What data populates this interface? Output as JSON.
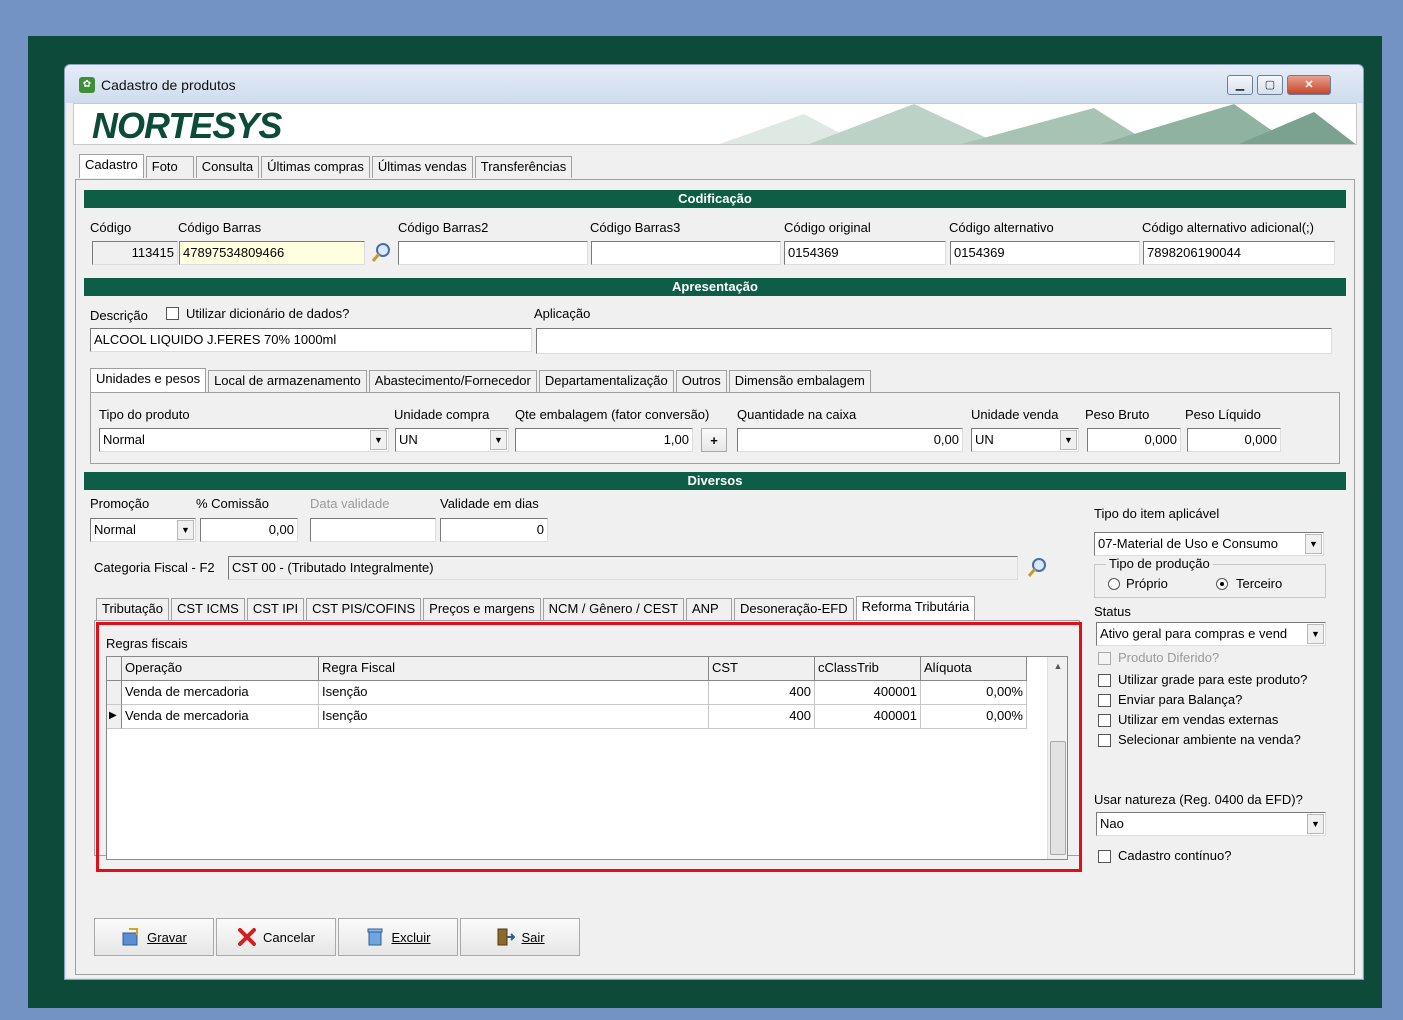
{
  "window": {
    "title": "Cadastro de produtos",
    "logo": "NORTESYS"
  },
  "main_tabs": [
    "Cadastro",
    "Foto",
    "Consulta",
    "Últimas compras",
    "Últimas vendas",
    "Transferências"
  ],
  "codificacao": {
    "header": "Codificação",
    "codigo_label": "Código",
    "codigo": "113415",
    "barras_label": "Código Barras",
    "barras": "47897534809466",
    "barras2_label": "Código Barras2",
    "barras2": "",
    "barras3_label": "Código Barras3",
    "barras3": "",
    "original_label": "Código original",
    "original": "0154369",
    "alternativo_label": "Código alternativo",
    "alternativo": "0154369",
    "alt_adicional_label": "Código alternativo adicional(;)",
    "alt_adicional": "7898206190044"
  },
  "apresentacao": {
    "header": "Apresentação",
    "descricao_label": "Descrição",
    "dicionario_label": "Utilizar dicionário de dados?",
    "descricao": "ALCOOL LIQUIDO J.FERES 70% 1000ml",
    "aplicacao_label": "Aplicação",
    "aplicacao": ""
  },
  "sub_tabs": [
    "Unidades e pesos",
    "Local de armazenamento",
    "Abastecimento/Fornecedor",
    "Departamentalização",
    "Outros",
    "Dimensão embalagem"
  ],
  "unidades": {
    "tipo_label": "Tipo do produto",
    "tipo": "Normal",
    "ucompra_label": "Unidade compra",
    "ucompra": "UN",
    "qte_label": "Qte embalagem (fator conversão)",
    "qte": "1,00",
    "plus": "+",
    "qcaixa_label": "Quantidade na caixa",
    "qcaixa": "0,00",
    "uvenda_label": "Unidade venda",
    "uvenda": "UN",
    "pbruto_label": "Peso Bruto",
    "pbruto": "0,000",
    "pliq_label": "Peso Líquido",
    "pliq": "0,000"
  },
  "diversos": {
    "header": "Diversos",
    "promocao_label": "Promoção",
    "promocao": "Normal",
    "comissao_label": "% Comissão",
    "comissao": "0,00",
    "datavalidade_label": "Data validade",
    "datavalidade": "",
    "validadedias_label": "Validade em dias",
    "validadedias": "0",
    "categoria_label": "Categoria Fiscal - F2",
    "categoria": "CST 00 - (Tributado Integralmente)"
  },
  "fiscal_tabs": [
    "Tributação",
    "CST ICMS",
    "CST IPI",
    "CST PIS/COFINS",
    "Preços e margens",
    "NCM / Gênero / CEST",
    "ANP",
    "Desoneração-EFD",
    "Reforma Tributária"
  ],
  "regras": {
    "title": "Regras fiscais",
    "columns": [
      "Operação",
      "Regra Fiscal",
      "CST",
      "cClassTrib",
      "Alíquota"
    ],
    "rows": [
      [
        "Venda de mercadoria",
        "Isenção",
        "400",
        "400001",
        "0,00%"
      ],
      [
        "Venda de mercadoria",
        "Isenção",
        "400",
        "400001",
        "0,00%"
      ]
    ]
  },
  "right": {
    "tipo_item_label": "Tipo do item aplicável",
    "tipo_item": "07-Material de Uso e Consumo",
    "producao_label": "Tipo de produção",
    "proprio": "Próprio",
    "terceiro": "Terceiro",
    "status_label": "Status",
    "status": "Ativo geral para compras e vend",
    "diferido": "Produto Diferido?",
    "grade": "Utilizar grade para este produto?",
    "balanca": "Enviar para Balança?",
    "externas": "Utilizar em vendas externas",
    "ambiente": "Selecionar ambiente na venda?",
    "natureza_label": "Usar natureza (Reg. 0400 da EFD)?",
    "natureza": "Nao",
    "continuo": "Cadastro contínuo?"
  },
  "buttons": {
    "gravar": "Gravar",
    "cancelar": "Cancelar",
    "excluir": "Excluir",
    "sair": "Sair"
  },
  "colors": {
    "band": "#0e5e46",
    "desktop": "#0d4a3a",
    "highlight": "#e0101a"
  }
}
